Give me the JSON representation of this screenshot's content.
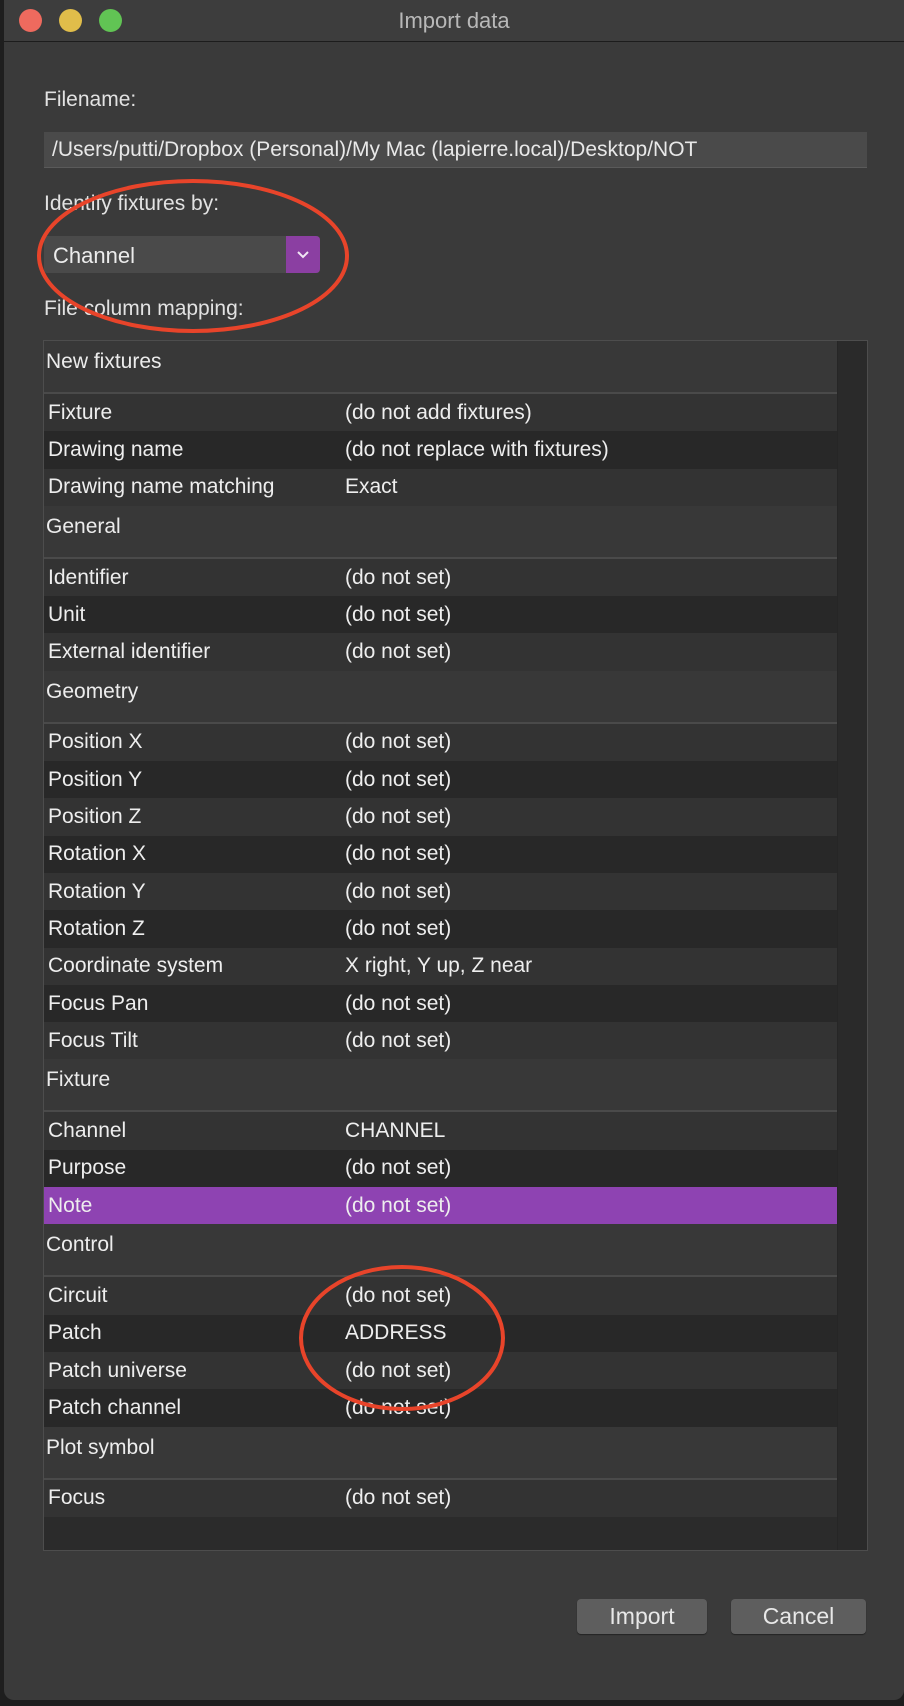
{
  "window": {
    "title": "Import data",
    "traffic_lights": {
      "close": "#ee6a5e",
      "minimize": "#e0bd4a",
      "zoom": "#61c454"
    }
  },
  "filename": {
    "label": "Filename:",
    "value": "/Users/putti/Dropbox (Personal)/My Mac (lapierre.local)/Desktop/NOT"
  },
  "identify": {
    "label": "Identify fixtures by:",
    "value": "Channel",
    "icon": "chevron-down-icon"
  },
  "mapping": {
    "label": "File column mapping:",
    "groups": [
      {
        "name": "New fixtures",
        "rows": [
          [
            "Fixture",
            "(do not add fixtures)"
          ],
          [
            "Drawing name",
            "(do not replace with fixtures)"
          ],
          [
            "Drawing name matching",
            "Exact"
          ]
        ]
      },
      {
        "name": "General",
        "rows": [
          [
            "Identifier",
            "(do not set)"
          ],
          [
            "Unit",
            "(do not set)"
          ],
          [
            "External identifier",
            "(do not set)"
          ]
        ]
      },
      {
        "name": "Geometry",
        "rows": [
          [
            "Position X",
            "(do not set)"
          ],
          [
            "Position Y",
            "(do not set)"
          ],
          [
            "Position Z",
            "(do not set)"
          ],
          [
            "Rotation X",
            "(do not set)"
          ],
          [
            "Rotation Y",
            "(do not set)"
          ],
          [
            "Rotation Z",
            "(do not set)"
          ],
          [
            "Coordinate system",
            "X right, Y up, Z near"
          ],
          [
            "Focus Pan",
            "(do not set)"
          ],
          [
            "Focus Tilt",
            "(do not set)"
          ]
        ]
      },
      {
        "name": "Fixture",
        "rows": [
          [
            "Channel",
            "CHANNEL"
          ],
          [
            "Purpose",
            "(do not set)"
          ],
          [
            "Note",
            "(do not set)"
          ]
        ]
      },
      {
        "name": "Control",
        "rows": [
          [
            "Circuit",
            "(do not set)"
          ],
          [
            "Patch",
            "ADDRESS"
          ],
          [
            "Patch universe",
            "(do not set)"
          ],
          [
            "Patch channel",
            "(do not set)"
          ]
        ]
      },
      {
        "name": "Plot symbol",
        "rows": [
          [
            "Focus",
            "(do not set)"
          ]
        ]
      }
    ],
    "selected_row": "Note"
  },
  "buttons": {
    "import": "Import",
    "cancel": "Cancel"
  },
  "colors": {
    "accent": "#8e43b2",
    "annotation": "#e8442a"
  }
}
